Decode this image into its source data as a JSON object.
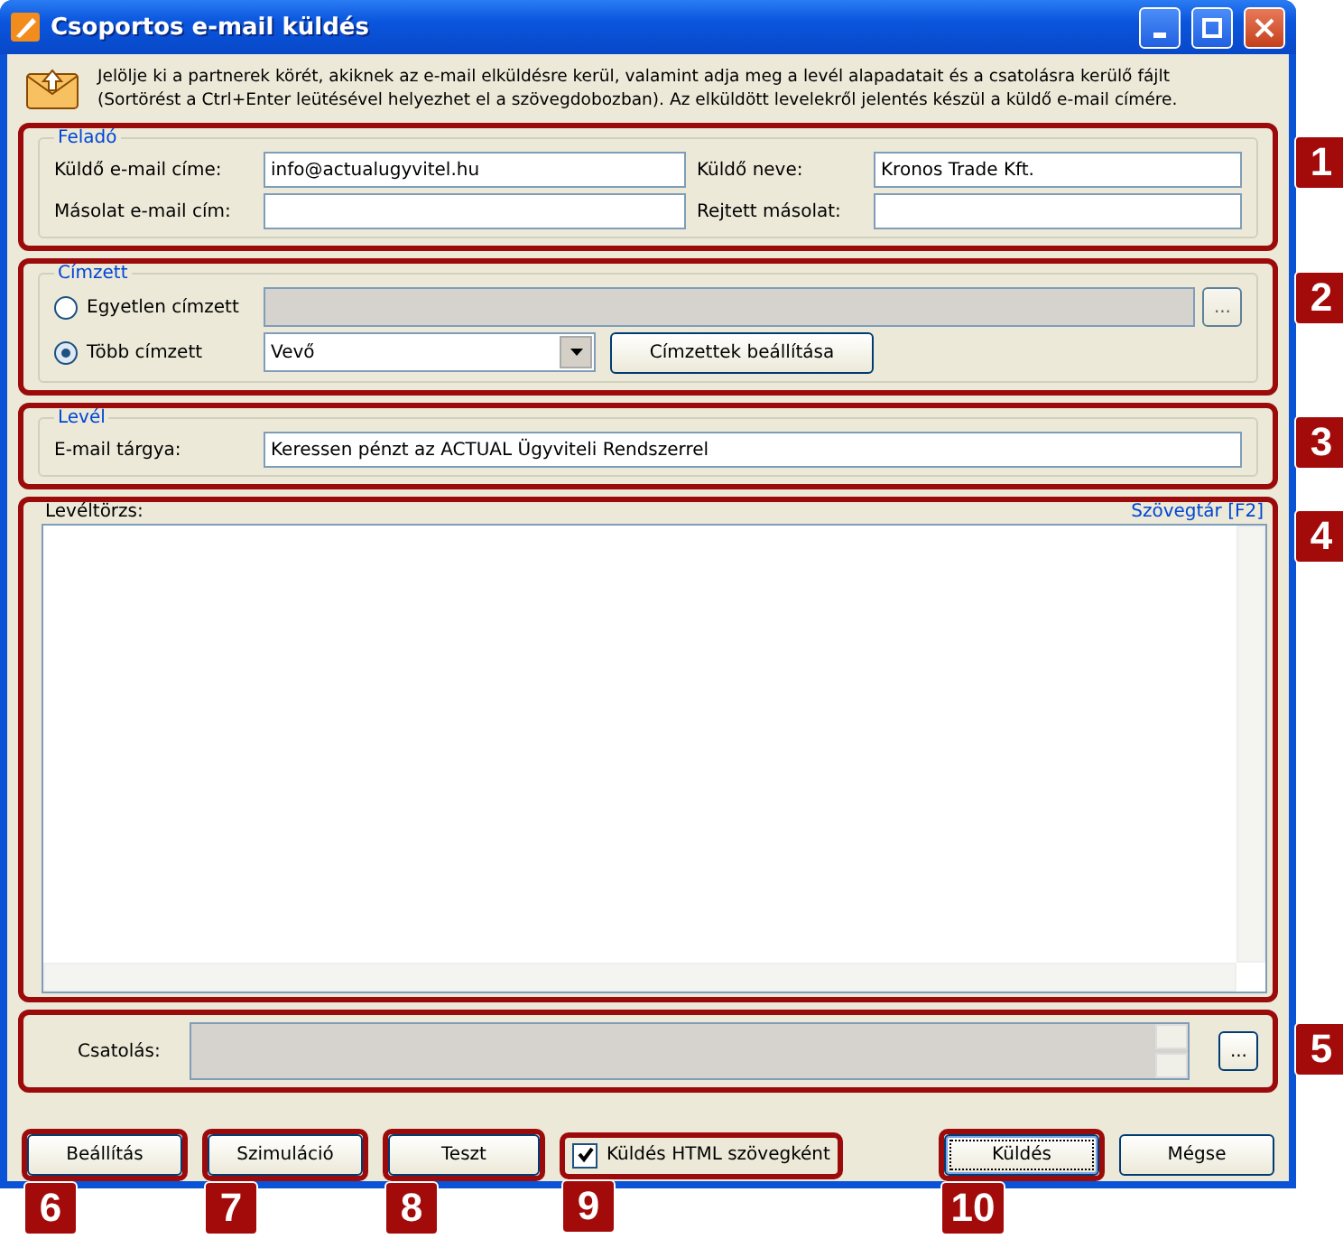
{
  "window": {
    "title": "Csoportos e-mail küldés"
  },
  "intro": {
    "lines": [
      "Jelölje ki a partnerek körét, akiknek az e-mail elküldésre kerül, valamint adja meg a levél alapadatait és a csatolásra kerülő fájlt",
      "(Sortörést a Ctrl+Enter leütésével helyezhet el a szövegdobozban). Az elküldött levelekről jelentés készül a küldő e-mail címére."
    ]
  },
  "sender": {
    "legend": "Feladó",
    "callout": "1",
    "fields": [
      {
        "label": "Küldő e-mail címe:",
        "value": "info@actualugyvitel.hu"
      },
      {
        "label": "Küldő neve:",
        "value": "Kronos Trade Kft."
      },
      {
        "label": "Másolat e-mail cím:"
      },
      {
        "label": "Rejtett másolat:"
      }
    ]
  },
  "recipients": {
    "legend": "Címzett",
    "callout": "2",
    "options": [
      {
        "label": "Egyetlen címzett",
        "selected": false
      },
      {
        "label": "Több címzett",
        "selected": true
      }
    ],
    "browse": "...",
    "group": "Vevő",
    "settings_button": "Címzettek beállítása"
  },
  "letter": {
    "legend": "Levél",
    "callout": "3",
    "subject_label": "E-mail tárgya:",
    "subject": "Keressen pénzt az ACTUAL Ügyviteli Rendszerrel"
  },
  "body": {
    "label": "Levéltörzs:",
    "link": "Szövegtár [F2]",
    "callout": "4"
  },
  "attachment": {
    "label": "Csatolás:",
    "browse": "...",
    "callout": "5"
  },
  "footer": [
    {
      "kind": "button",
      "label": "Beállítás",
      "callout": "6",
      "default": false
    },
    {
      "kind": "button",
      "label": "Szimuláció",
      "callout": "7",
      "default": false
    },
    {
      "kind": "button",
      "label": "Teszt",
      "callout": "8",
      "default": false
    },
    {
      "kind": "checkbox",
      "label": "Küldés HTML szövegként",
      "checked": true,
      "callout": "9"
    },
    {
      "kind": "button",
      "label": "Küldés",
      "callout": "10",
      "default": true
    },
    {
      "kind": "button",
      "label": "Mégse",
      "default": false
    }
  ]
}
